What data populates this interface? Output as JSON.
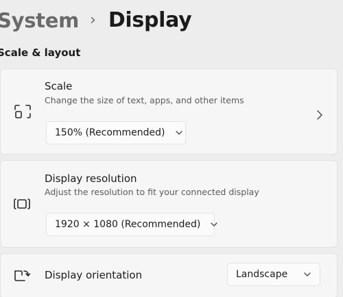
{
  "header": {
    "breadcrumb_parent": "System",
    "breadcrumb_separator": "›",
    "breadcrumb_current": "Display"
  },
  "section": {
    "title": "Scale & layout"
  },
  "scale": {
    "icon": "scale-icon",
    "title": "Scale",
    "description": "Change the size of text, apps, and other items",
    "selected": "150% (Recommended)",
    "expand_icon": "chevron-right-icon"
  },
  "resolution": {
    "icon": "display-resolution-icon",
    "title": "Display resolution",
    "description": "Adjust the resolution to fit your connected display",
    "selected": "1920 × 1080 (Recommended)"
  },
  "orientation": {
    "icon": "display-orientation-icon",
    "title": "Display orientation",
    "selected": "Landscape"
  },
  "colors": {
    "background": "#ededed",
    "card": "#f6f6f6",
    "text_primary": "#1b1b1b",
    "text_secondary": "#5a5a5a"
  }
}
